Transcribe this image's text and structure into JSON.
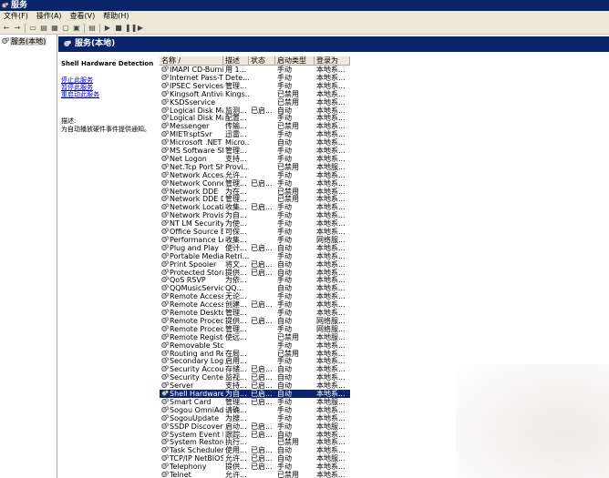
{
  "window": {
    "title": "服务"
  },
  "menu": [
    "文件(F)",
    "操作(A)",
    "查看(V)",
    "帮助(H)"
  ],
  "tree": {
    "root_label": "服务(本地)"
  },
  "panel": {
    "title": "服务(本地)"
  },
  "description": {
    "service_name": "Shell Hardware Detection",
    "links": [
      "停止此服务",
      "暂停此服务",
      "重启动此服务"
    ],
    "label": "描述:",
    "text": "为自动播放硬件事件提供通知。"
  },
  "columns": [
    "名称 /",
    "描述",
    "状态",
    "启动类型",
    "登录为"
  ],
  "services": [
    [
      "IMAPI CD-Burnin...",
      "用 1...",
      "",
      "手动",
      "本地系..."
    ],
    [
      "Internet Pass-T...",
      "Dete...",
      "",
      "手动",
      "本地系..."
    ],
    [
      "IPSEC Services",
      "管理...",
      "",
      "手动",
      "本地系..."
    ],
    [
      "Kingsoft Antiviru...",
      "Kings...",
      "",
      "已禁用",
      "本地系..."
    ],
    [
      "KSDSservice",
      "",
      "",
      "已禁用",
      "本地系..."
    ],
    [
      "Logical Disk Man...",
      "监测...",
      "已启...",
      "自动",
      "本地系..."
    ],
    [
      "Logical Disk Man...",
      "配置...",
      "",
      "手动",
      "本地系..."
    ],
    [
      "Messenger",
      "传输...",
      "",
      "已禁用",
      "本地系..."
    ],
    [
      "MIETrsptSvr",
      "迅雷...",
      "",
      "手动",
      "本地系..."
    ],
    [
      "Microsoft .NET F...",
      "Micro...",
      "",
      "自动",
      "本地系..."
    ],
    [
      "MS Software Sh...",
      "管理...",
      "",
      "手动",
      "本地系..."
    ],
    [
      "Net Logon",
      "支持...",
      "",
      "手动",
      "本地系..."
    ],
    [
      "Net.Tcp Port Sh...",
      "Provi...",
      "",
      "已禁用",
      "本地服..."
    ],
    [
      "Network Access ...",
      "允许...",
      "",
      "手动",
      "本地系..."
    ],
    [
      "Network Connec...",
      "管理...",
      "已启...",
      "手动",
      "本地系..."
    ],
    [
      "Network DDE",
      "为在...",
      "",
      "已禁用",
      "本地系..."
    ],
    [
      "Network DDE DS...",
      "管理...",
      "",
      "已禁用",
      "本地系..."
    ],
    [
      "Network Locatio...",
      "收集...",
      "已启...",
      "手动",
      "本地系..."
    ],
    [
      "Network Provisi...",
      "为自...",
      "",
      "手动",
      "本地系..."
    ],
    [
      "NT LM Security ...",
      "为使...",
      "",
      "手动",
      "本地系..."
    ],
    [
      "Office Source E...",
      "可保...",
      "",
      "手动",
      "本地系..."
    ],
    [
      "Performance Lo...",
      "收集...",
      "",
      "手动",
      "网络服..."
    ],
    [
      "Plug and Play",
      "使计...",
      "已启...",
      "自动",
      "本地系..."
    ],
    [
      "Portable Media ...",
      "Retri...",
      "",
      "手动",
      "本地系..."
    ],
    [
      "Print Spooler",
      "将文...",
      "已启...",
      "自动",
      "本地系..."
    ],
    [
      "Protected Storage",
      "提供...",
      "已启...",
      "自动",
      "本地系..."
    ],
    [
      "QoS RSVP",
      "为依...",
      "",
      "手动",
      "本地系..."
    ],
    [
      "QQMusicService",
      "QQ...",
      "",
      "自动",
      "本地系..."
    ],
    [
      "Remote Access ...",
      "无论...",
      "",
      "手动",
      "本地系..."
    ],
    [
      "Remote Access ...",
      "创建...",
      "已启...",
      "手动",
      "本地系..."
    ],
    [
      "Remote Desktop...",
      "管理...",
      "",
      "手动",
      "本地系..."
    ],
    [
      "Remote Procedu...",
      "提供...",
      "已启...",
      "自动",
      "网络服..."
    ],
    [
      "Remote Procedu...",
      "管理...",
      "",
      "手动",
      "网络服..."
    ],
    [
      "Remote Registry",
      "使远...",
      "",
      "已禁用",
      "本地服..."
    ],
    [
      "Removable Stor...",
      "",
      "",
      "手动",
      "本地系..."
    ],
    [
      "Routing and Re...",
      "在局...",
      "",
      "已禁用",
      "本地系..."
    ],
    [
      "Secondary Logon",
      "启用...",
      "",
      "手动",
      "本地系..."
    ],
    [
      "Security Accoun...",
      "存储...",
      "已启...",
      "自动",
      "本地系..."
    ],
    [
      "Security Center",
      "监视...",
      "已启...",
      "自动",
      "本地系..."
    ],
    [
      "Server",
      "支持...",
      "已启...",
      "自动",
      "本地系..."
    ],
    [
      "Shell Hardware ...",
      "为自...",
      "已启...",
      "自动",
      "本地系..."
    ],
    [
      "Smart Card",
      "管理...",
      "已启...",
      "手动",
      "本地服..."
    ],
    [
      "Sogou OmniAdd...",
      "请确...",
      "",
      "手动",
      "本地系..."
    ],
    [
      "SogouUpdate",
      "为搜...",
      "",
      "手动",
      "本地系..."
    ],
    [
      "SSDP Discovery ...",
      "启动...",
      "已启...",
      "手动",
      "本地服..."
    ],
    [
      "System Event N...",
      "跟踪...",
      "已启...",
      "自动",
      "本地系..."
    ],
    [
      "System Restore ...",
      "执行...",
      "",
      "已禁用",
      "本地系..."
    ],
    [
      "Task Scheduler",
      "使用...",
      "已启...",
      "自动",
      "本地系..."
    ],
    [
      "TCP/IP NetBIOS ...",
      "允许...",
      "已启...",
      "自动",
      "本地服..."
    ],
    [
      "Telephony",
      "提供...",
      "已启...",
      "手动",
      "本地系..."
    ],
    [
      "Telnet",
      "允许...",
      "",
      "已禁用",
      "本地系..."
    ]
  ],
  "selected_index": 40
}
